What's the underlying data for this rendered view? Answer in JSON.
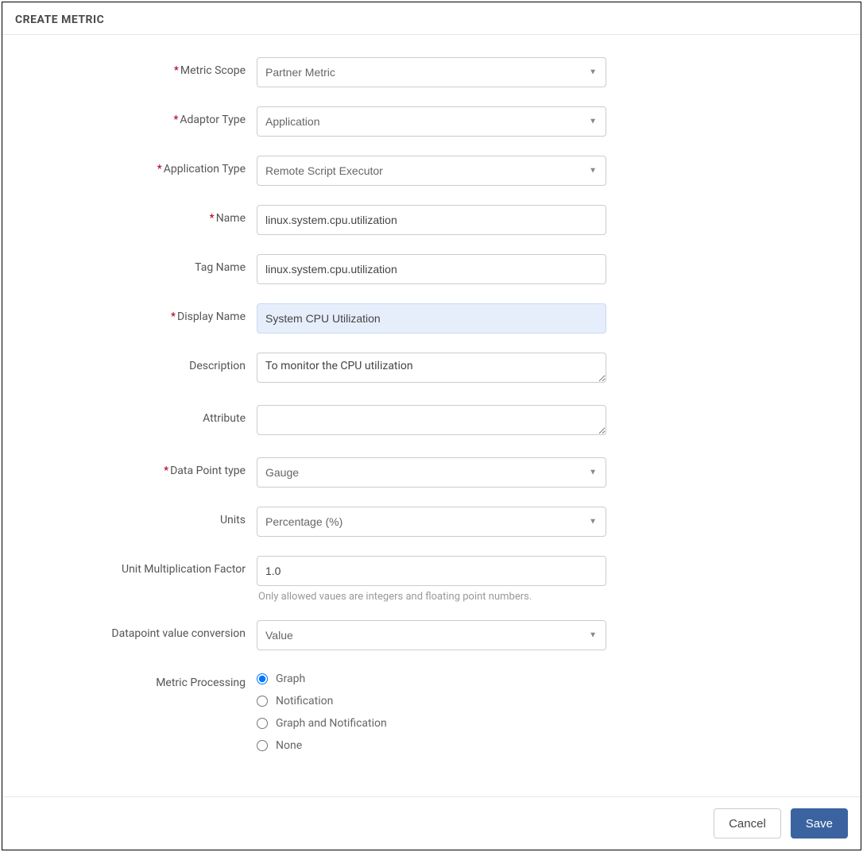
{
  "title": "CREATE METRIC",
  "labels": {
    "metricScope": "Metric Scope",
    "adaptorType": "Adaptor Type",
    "applicationType": "Application Type",
    "name": "Name",
    "tagName": "Tag Name",
    "displayName": "Display Name",
    "description": "Description",
    "attribute": "Attribute",
    "dataPointType": "Data Point type",
    "units": "Units",
    "unitMultFactor": "Unit Multiplication Factor",
    "datapointValueConv": "Datapoint value conversion",
    "metricProcessing": "Metric Processing"
  },
  "values": {
    "metricScope": "Partner Metric",
    "adaptorType": "Application",
    "applicationType": "Remote Script Executor",
    "name": "linux.system.cpu.utilization",
    "tagName": "linux.system.cpu.utilization",
    "displayName": "System CPU Utilization",
    "description": "To monitor the CPU utilization",
    "attribute": "",
    "dataPointType": "Gauge",
    "units": "Percentage (%)",
    "unitMultFactor": "1.0",
    "datapointValueConv": "Value"
  },
  "helperText": {
    "unitMultFactor": "Only allowed vaues are integers and floating point numbers."
  },
  "radios": {
    "graph": "Graph",
    "notification": "Notification",
    "graphAndNotification": "Graph and Notification",
    "none": "None"
  },
  "buttons": {
    "cancel": "Cancel",
    "save": "Save"
  }
}
